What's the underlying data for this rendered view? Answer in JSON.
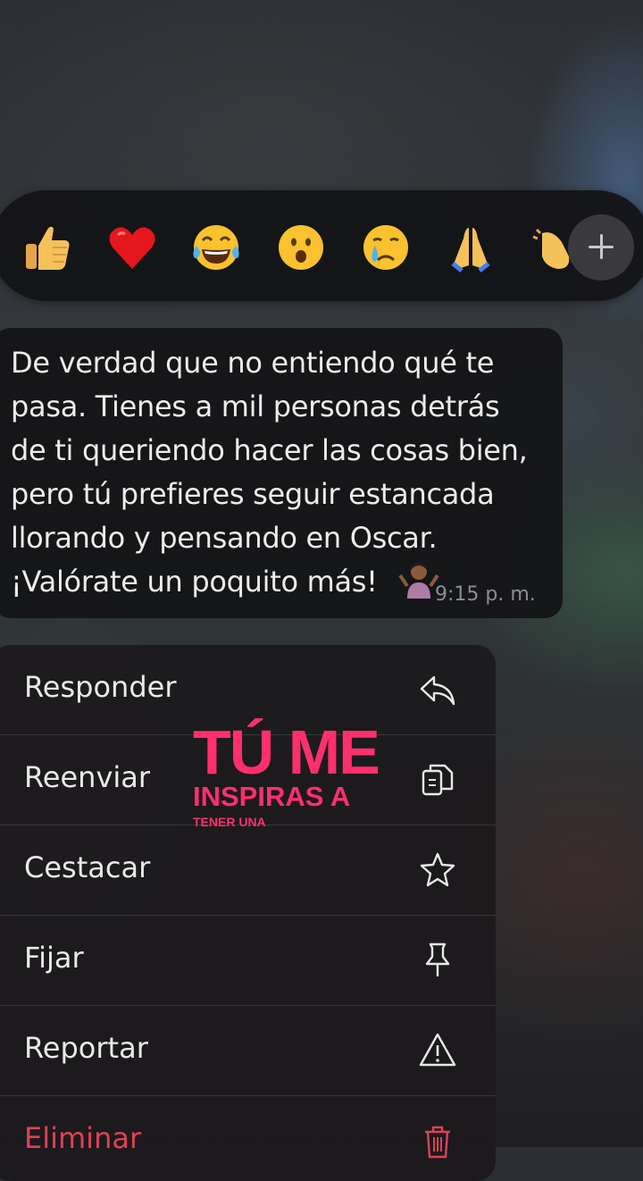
{
  "reactions": {
    "items": [
      {
        "name": "thumbs-up",
        "glyph": "👍"
      },
      {
        "name": "red-heart",
        "glyph": "❤️"
      },
      {
        "name": "tears-of-joy",
        "glyph": "😂"
      },
      {
        "name": "surprised",
        "glyph": "😮"
      },
      {
        "name": "crying",
        "glyph": "😢"
      },
      {
        "name": "folded-hands",
        "glyph": "🙏"
      },
      {
        "name": "clapping-hands",
        "glyph": "👏"
      }
    ],
    "more_icon": "plus-icon"
  },
  "message": {
    "lines": [
      "De verdad que no entiendo qué te",
      "pasa. Tienes a mil personas detrás",
      "de ti queriendo hacer las cosas bien,",
      "pero tú prefieres seguir estancada",
      "llorando y pensando en Oscar.",
      "¡Valórate un poquito más!"
    ],
    "emoji": "🤷🏽‍♀️",
    "time": "9:15 p. m."
  },
  "menu": {
    "items": [
      {
        "label": "Responder",
        "icon": "reply-icon"
      },
      {
        "label": "Reenviar",
        "icon": "copy-icon"
      },
      {
        "label": "Cestacar",
        "icon": "star-icon"
      },
      {
        "label": "Fijar",
        "icon": "pin-icon"
      },
      {
        "label": "Reportar",
        "icon": "warning-icon"
      },
      {
        "label": "Eliminar",
        "icon": "trash-icon"
      }
    ]
  },
  "overlay": {
    "line1": "TÚ ME",
    "line2": "INSPIRAS A",
    "line3": "TENER UNA"
  },
  "colors": {
    "overlay_text": "#ff2f6d",
    "danger": "#e0405a",
    "bubble": "#141416"
  }
}
